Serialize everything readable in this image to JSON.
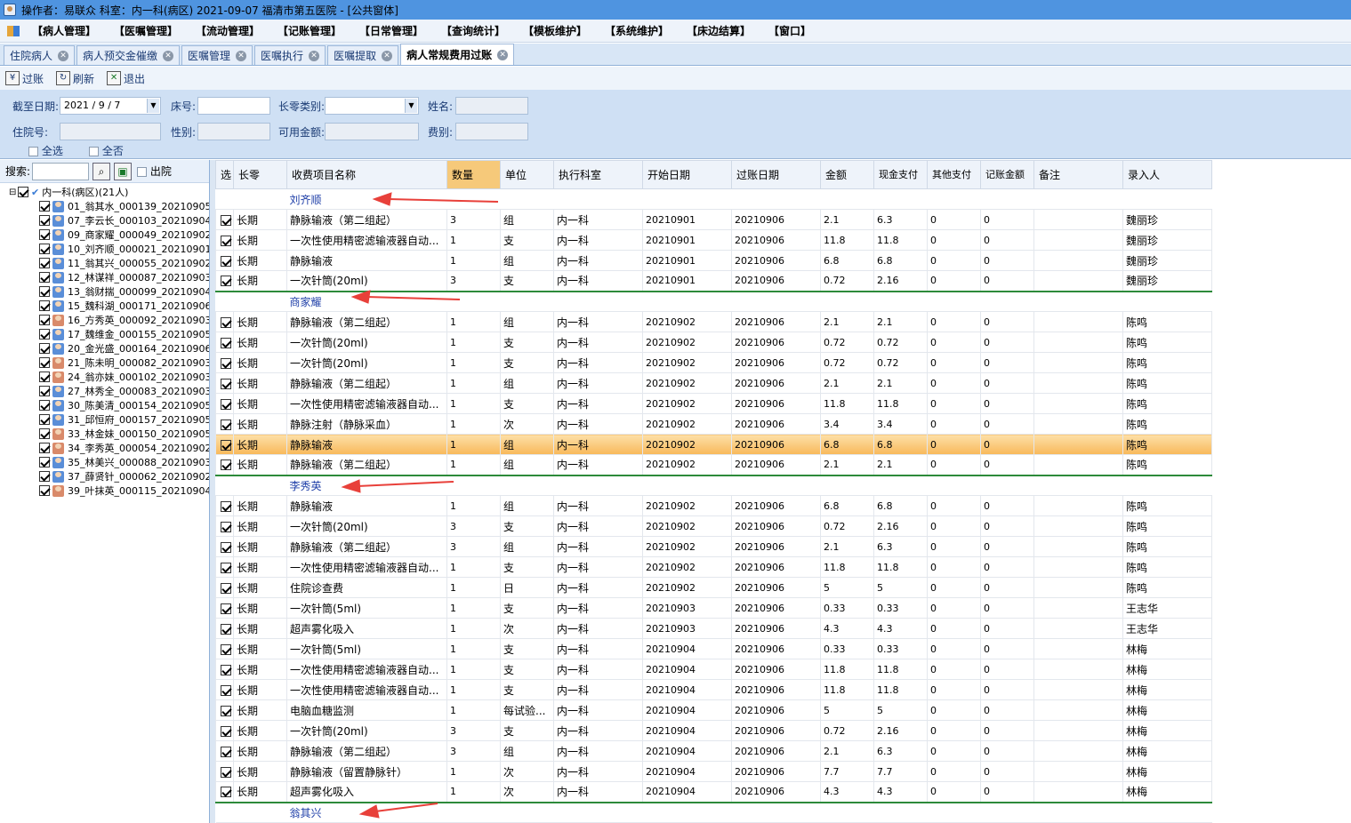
{
  "titlebar": {
    "text": "操作者：易联众  科室：内一科(病区)  2021-09-07  福清市第五医院 - [公共窗体]"
  },
  "menu": [
    "【病人管理】",
    "【医嘱管理】",
    "【流动管理】",
    "【记账管理】",
    "【日常管理】",
    "【查询统计】",
    "【模板维护】",
    "【系统维护】",
    "【床边结算】",
    "【窗口】"
  ],
  "tabs": [
    {
      "label": "住院病人",
      "active": false
    },
    {
      "label": "病人预交金催缴",
      "active": false
    },
    {
      "label": "医嘱管理",
      "active": false
    },
    {
      "label": "医嘱执行",
      "active": false
    },
    {
      "label": "医嘱提取",
      "active": false
    },
    {
      "label": "病人常规费用过账",
      "active": true
    }
  ],
  "toolbar": {
    "post": "过账",
    "refresh": "刷新",
    "exit": "退出"
  },
  "filter": {
    "date_label": "截至日期:",
    "date_value": "2021 / 9 / 7",
    "bed_label": "床号:",
    "type_label": "长零类别:",
    "name_label": "姓名:",
    "inpatient_label": "住院号:",
    "gender_label": "性别:",
    "amount_label": "可用金额:",
    "fee_label": "费别:",
    "select_all": "全选",
    "select_none": "全否"
  },
  "left": {
    "search_label": "搜索:",
    "discharged_label": "出院",
    "root": "内一科(病区)(21人)",
    "patients": [
      {
        "label": "01_翁其水_000139_20210905_",
        "f": false
      },
      {
        "label": "07_李云长_000103_20210904_",
        "f": false
      },
      {
        "label": "09_商家耀_000049_20210902_",
        "f": false
      },
      {
        "label": "10_刘齐顺_000021_20210901_",
        "f": false
      },
      {
        "label": "11_翁其兴_000055_20210902_",
        "f": false
      },
      {
        "label": "12_林谋祥_000087_20210903_",
        "f": false
      },
      {
        "label": "13_翁财揣_000099_20210904_",
        "f": false
      },
      {
        "label": "15_魏科湖_000171_20210906_",
        "f": false
      },
      {
        "label": "16_方秀英_000092_20210903_",
        "f": true
      },
      {
        "label": "17_魏维金_000155_20210905_",
        "f": false
      },
      {
        "label": "20_金光盛_000164_20210906_",
        "f": false
      },
      {
        "label": "21_陈未明_000082_20210903_",
        "f": true
      },
      {
        "label": "24_翁亦妹_000102_20210903_",
        "f": true
      },
      {
        "label": "27_林秀全_000083_20210903_",
        "f": false
      },
      {
        "label": "30_陈美清_000154_20210905_",
        "f": false
      },
      {
        "label": "31_邱恒府_000157_20210905_",
        "f": false
      },
      {
        "label": "33_林金妹_000150_20210905_",
        "f": true
      },
      {
        "label": "34_李秀英_000054_20210902_",
        "f": true
      },
      {
        "label": "35_林美兴_000088_20210903_",
        "f": false
      },
      {
        "label": "37_薛贤针_000062_20210902_",
        "f": false
      },
      {
        "label": "39_叶抹英_000115_20210904_",
        "f": true
      }
    ]
  },
  "grid": {
    "headers": [
      "选",
      "长零",
      "收费项目名称",
      "数量",
      "单位",
      "执行科室",
      "开始日期",
      "过账日期",
      "金额",
      "现金支付",
      "其他支付",
      "记账金额",
      "备注",
      "录入人"
    ],
    "rows": [
      {
        "g": "刘齐顺"
      },
      {
        "c": [
          "长期",
          "静脉输液（第二组起）",
          "3",
          "组",
          "内一科",
          "20210901",
          "20210906",
          "2.1",
          "6.3",
          "0",
          "0",
          "",
          "魏丽珍"
        ]
      },
      {
        "c": [
          "长期",
          "一次性使用精密滤输液器自动...",
          "1",
          "支",
          "内一科",
          "20210901",
          "20210906",
          "11.8",
          "11.8",
          "0",
          "0",
          "",
          "魏丽珍"
        ]
      },
      {
        "c": [
          "长期",
          "静脉输液",
          "1",
          "组",
          "内一科",
          "20210901",
          "20210906",
          "6.8",
          "6.8",
          "0",
          "0",
          "",
          "魏丽珍"
        ]
      },
      {
        "c": [
          "长期",
          "一次针筒(20ml)",
          "3",
          "支",
          "内一科",
          "20210901",
          "20210906",
          "0.72",
          "2.16",
          "0",
          "0",
          "",
          "魏丽珍"
        ]
      },
      {
        "g": "商家耀"
      },
      {
        "c": [
          "长期",
          "静脉输液（第二组起）",
          "1",
          "组",
          "内一科",
          "20210902",
          "20210906",
          "2.1",
          "2.1",
          "0",
          "0",
          "",
          "陈鸣"
        ]
      },
      {
        "c": [
          "长期",
          "一次针筒(20ml)",
          "1",
          "支",
          "内一科",
          "20210902",
          "20210906",
          "0.72",
          "0.72",
          "0",
          "0",
          "",
          "陈鸣"
        ]
      },
      {
        "c": [
          "长期",
          "一次针筒(20ml)",
          "1",
          "支",
          "内一科",
          "20210902",
          "20210906",
          "0.72",
          "0.72",
          "0",
          "0",
          "",
          "陈鸣"
        ]
      },
      {
        "c": [
          "长期",
          "静脉输液（第二组起）",
          "1",
          "组",
          "内一科",
          "20210902",
          "20210906",
          "2.1",
          "2.1",
          "0",
          "0",
          "",
          "陈鸣"
        ]
      },
      {
        "c": [
          "长期",
          "一次性使用精密滤输液器自动...",
          "1",
          "支",
          "内一科",
          "20210902",
          "20210906",
          "11.8",
          "11.8",
          "0",
          "0",
          "",
          "陈鸣"
        ]
      },
      {
        "c": [
          "长期",
          "静脉注射（静脉采血）",
          "1",
          "次",
          "内一科",
          "20210902",
          "20210906",
          "3.4",
          "3.4",
          "0",
          "0",
          "",
          "陈鸣"
        ]
      },
      {
        "c": [
          "长期",
          "静脉输液",
          "1",
          "组",
          "内一科",
          "20210902",
          "20210906",
          "6.8",
          "6.8",
          "0",
          "0",
          "",
          "陈鸣"
        ],
        "sel": true
      },
      {
        "c": [
          "长期",
          "静脉输液（第二组起）",
          "1",
          "组",
          "内一科",
          "20210902",
          "20210906",
          "2.1",
          "2.1",
          "0",
          "0",
          "",
          "陈鸣"
        ]
      },
      {
        "g": "李秀英"
      },
      {
        "c": [
          "长期",
          "静脉输液",
          "1",
          "组",
          "内一科",
          "20210902",
          "20210906",
          "6.8",
          "6.8",
          "0",
          "0",
          "",
          "陈鸣"
        ]
      },
      {
        "c": [
          "长期",
          "一次针筒(20ml)",
          "3",
          "支",
          "内一科",
          "20210902",
          "20210906",
          "0.72",
          "2.16",
          "0",
          "0",
          "",
          "陈鸣"
        ]
      },
      {
        "c": [
          "长期",
          "静脉输液（第二组起）",
          "3",
          "组",
          "内一科",
          "20210902",
          "20210906",
          "2.1",
          "6.3",
          "0",
          "0",
          "",
          "陈鸣"
        ]
      },
      {
        "c": [
          "长期",
          "一次性使用精密滤输液器自动...",
          "1",
          "支",
          "内一科",
          "20210902",
          "20210906",
          "11.8",
          "11.8",
          "0",
          "0",
          "",
          "陈鸣"
        ]
      },
      {
        "c": [
          "长期",
          "住院诊查费",
          "1",
          "日",
          "内一科",
          "20210902",
          "20210906",
          "5",
          "5",
          "0",
          "0",
          "",
          "陈鸣"
        ]
      },
      {
        "c": [
          "长期",
          "一次针筒(5ml)",
          "1",
          "支",
          "内一科",
          "20210903",
          "20210906",
          "0.33",
          "0.33",
          "0",
          "0",
          "",
          "王志华"
        ]
      },
      {
        "c": [
          "长期",
          "超声雾化吸入",
          "1",
          "次",
          "内一科",
          "20210903",
          "20210906",
          "4.3",
          "4.3",
          "0",
          "0",
          "",
          "王志华"
        ]
      },
      {
        "c": [
          "长期",
          "一次针筒(5ml)",
          "1",
          "支",
          "内一科",
          "20210904",
          "20210906",
          "0.33",
          "0.33",
          "0",
          "0",
          "",
          "林梅"
        ]
      },
      {
        "c": [
          "长期",
          "一次性使用精密滤输液器自动...",
          "1",
          "支",
          "内一科",
          "20210904",
          "20210906",
          "11.8",
          "11.8",
          "0",
          "0",
          "",
          "林梅"
        ]
      },
      {
        "c": [
          "长期",
          "一次性使用精密滤输液器自动...",
          "1",
          "支",
          "内一科",
          "20210904",
          "20210906",
          "11.8",
          "11.8",
          "0",
          "0",
          "",
          "林梅"
        ]
      },
      {
        "c": [
          "长期",
          "电脑血糖监测",
          "1",
          "每试验...",
          "内一科",
          "20210904",
          "20210906",
          "5",
          "5",
          "0",
          "0",
          "",
          "林梅"
        ]
      },
      {
        "c": [
          "长期",
          "一次针筒(20ml)",
          "3",
          "支",
          "内一科",
          "20210904",
          "20210906",
          "0.72",
          "2.16",
          "0",
          "0",
          "",
          "林梅"
        ]
      },
      {
        "c": [
          "长期",
          "静脉输液（第二组起）",
          "3",
          "组",
          "内一科",
          "20210904",
          "20210906",
          "2.1",
          "6.3",
          "0",
          "0",
          "",
          "林梅"
        ]
      },
      {
        "c": [
          "长期",
          "静脉输液（留置静脉针）",
          "1",
          "次",
          "内一科",
          "20210904",
          "20210906",
          "7.7",
          "7.7",
          "0",
          "0",
          "",
          "林梅"
        ]
      },
      {
        "c": [
          "长期",
          "超声雾化吸入",
          "1",
          "次",
          "内一科",
          "20210904",
          "20210906",
          "4.3",
          "4.3",
          "0",
          "0",
          "",
          "林梅"
        ]
      },
      {
        "g": "翁其兴"
      }
    ]
  },
  "colors": {
    "arrow": "#e8403a",
    "group_line": "#2d8a3a",
    "selected": "#f8b85a",
    "title": "#4f94e0"
  }
}
